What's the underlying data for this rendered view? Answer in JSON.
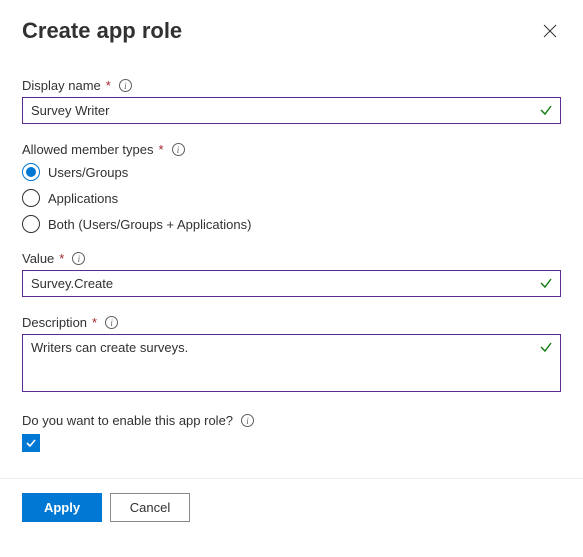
{
  "header": {
    "title": "Create app role"
  },
  "fields": {
    "displayName": {
      "label": "Display name",
      "value": "Survey Writer"
    },
    "memberTypes": {
      "label": "Allowed member types",
      "options": [
        {
          "label": "Users/Groups",
          "selected": true
        },
        {
          "label": "Applications",
          "selected": false
        },
        {
          "label": "Both (Users/Groups + Applications)",
          "selected": false
        }
      ]
    },
    "value": {
      "label": "Value",
      "value": "Survey.Create"
    },
    "description": {
      "label": "Description",
      "value": "Writers can create surveys."
    },
    "enable": {
      "label": "Do you want to enable this app role?",
      "checked": true
    }
  },
  "footer": {
    "apply": "Apply",
    "cancel": "Cancel"
  }
}
